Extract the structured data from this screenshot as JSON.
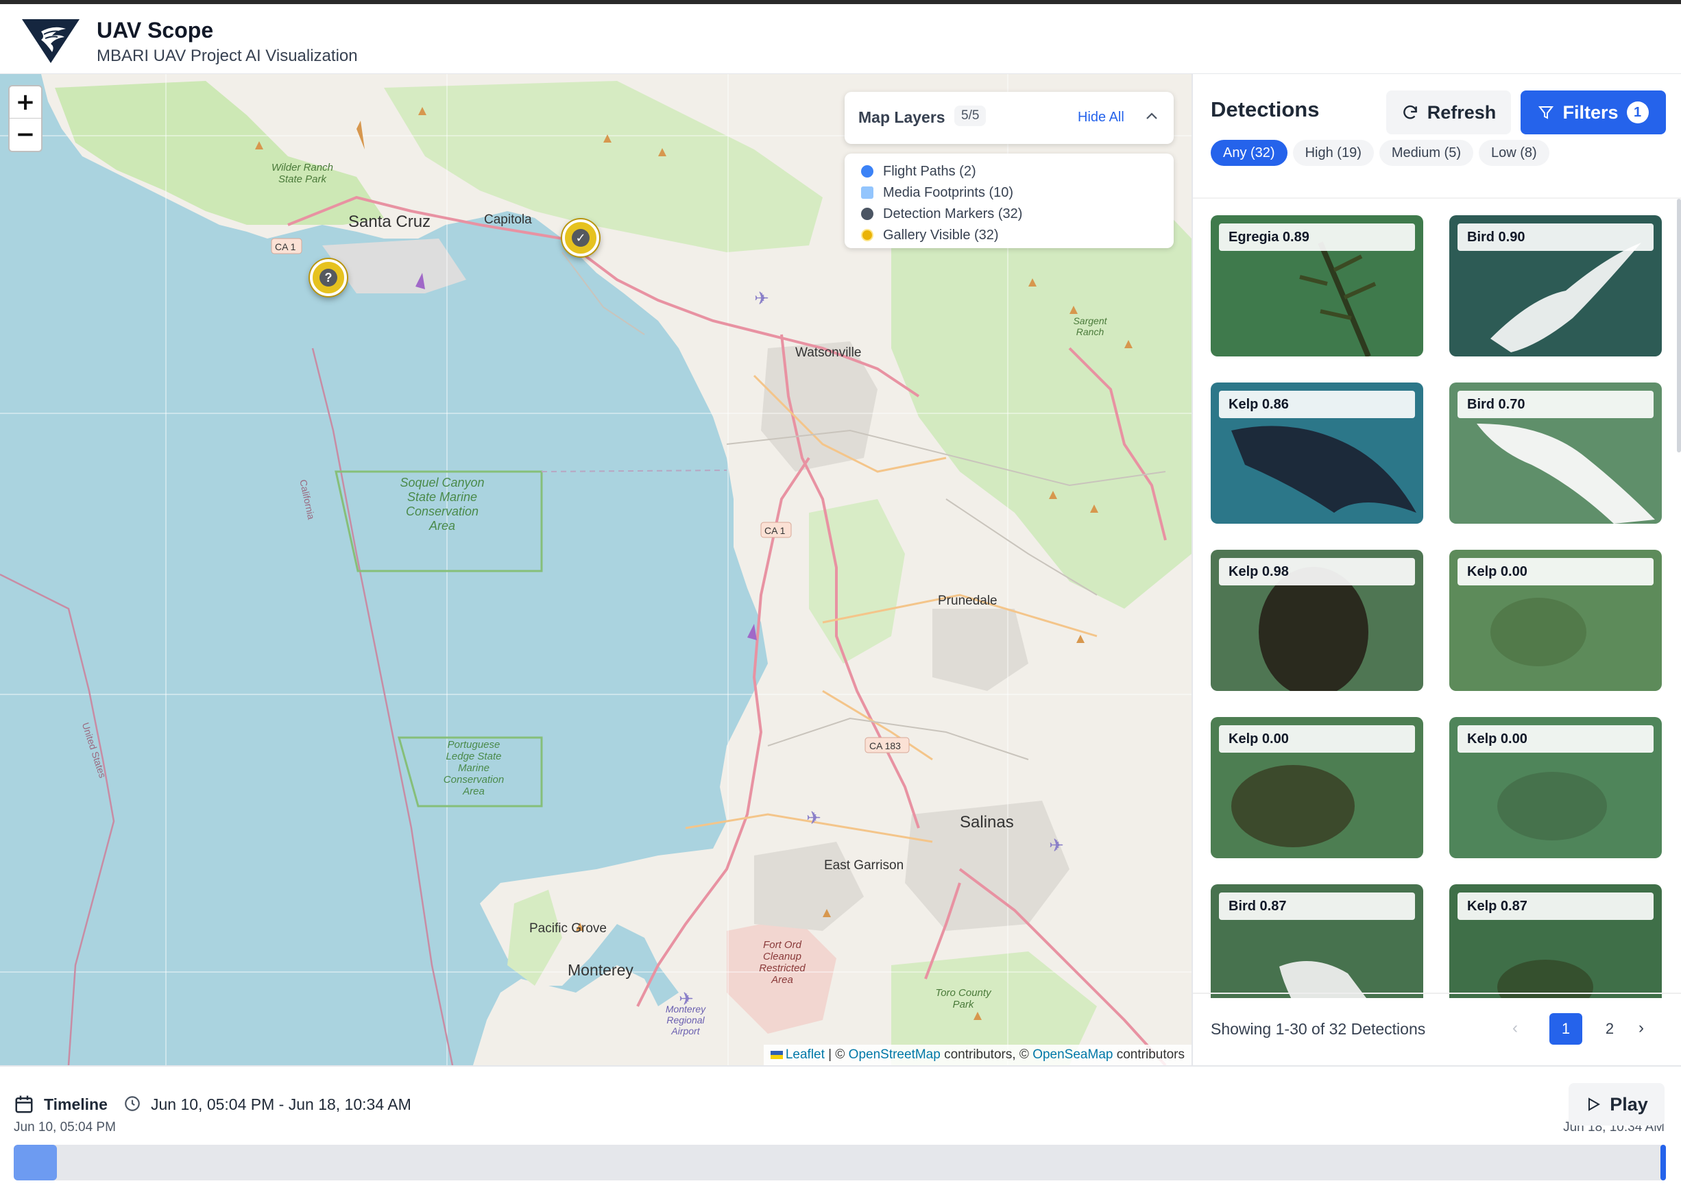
{
  "app": {
    "title": "UAV Scope",
    "subtitle": "MBARI UAV Project AI Visualization",
    "logo_icon": "stingray-logo-icon"
  },
  "map": {
    "zoom_in_label": "+",
    "zoom_out_label": "−",
    "places": {
      "santa_cruz": "Santa Cruz",
      "capitola": "Capitola",
      "watsonville": "Watsonville",
      "prunedale": "Prunedale",
      "salinas": "Salinas",
      "east_garrison": "East Garrison",
      "pacific_grove": "Pacific Grove",
      "monterey": "Monterey",
      "wilder_ranch": "Wilder Ranch State Park",
      "soquel_canyon": "Soquel Canyon State Marine Conservation Area",
      "portuguese_ledge": "Portuguese Ledge State Marine Conservation Area",
      "fort_ord": "Fort Ord Cleanup Restricted Area",
      "toro_park": "Toro County Park",
      "sargent_ranch": "Sargent Ranch",
      "monterey_airport": "Monterey Regional Airport",
      "california": "California",
      "united_states": "United States",
      "ca1_a": "CA 1",
      "ca1_b": "CA 1",
      "ca183": "CA 183"
    },
    "attribution": {
      "leaflet": "Leaflet",
      "sep": " | © ",
      "osm": "OpenStreetMap",
      "contrib1": " contributors, © ",
      "osmap": "OpenSeaMap",
      "contrib2": " contributors"
    },
    "markers": [
      {
        "icon": "question-icon",
        "glyph": "?"
      },
      {
        "icon": "check-icon",
        "glyph": "✓"
      }
    ]
  },
  "layers": {
    "title": "Map Layers",
    "count": "5/5",
    "hide_all": "Hide All",
    "items": [
      {
        "label": "Flight Paths (2)",
        "color": "#3b82f6"
      },
      {
        "label": "Media Footprints (10)",
        "color": "#93c5fd"
      },
      {
        "label": "Detection Markers (32)",
        "color": "#4b5563"
      },
      {
        "label": "Gallery Visible (32)",
        "color": "#eab308"
      }
    ]
  },
  "detections": {
    "title": "Detections",
    "refresh_label": "Refresh",
    "filters_label": "Filters",
    "filters_count": "1",
    "chips": [
      "Any (32)",
      "High (19)",
      "Medium (5)",
      "Low (8)"
    ],
    "active_chip": "Any (32)",
    "cards": [
      {
        "label": "Egregia 0.89",
        "bg": "#3f7a4c"
      },
      {
        "label": "Bird 0.90",
        "bg": "#2d5b55"
      },
      {
        "label": "Kelp 0.86",
        "bg": "#2c7789"
      },
      {
        "label": "Bird 0.70",
        "bg": "#5f8f6a"
      },
      {
        "label": "Kelp 0.98",
        "bg": "#4f7653"
      },
      {
        "label": "Kelp 0.00",
        "bg": "#5d8b5a"
      },
      {
        "label": "Kelp 0.00",
        "bg": "#4d7e52"
      },
      {
        "label": "Kelp 0.00",
        "bg": "#4f855a"
      },
      {
        "label": "Bird 0.87",
        "bg": "#47724e"
      },
      {
        "label": "Kelp 0.87",
        "bg": "#3f6f48"
      }
    ],
    "pager": {
      "summary": "Showing 1-30 of 32 Detections",
      "prev": "‹",
      "page1": "1",
      "page2": "2",
      "next": "›"
    }
  },
  "timeline": {
    "label": "Timeline",
    "range": "Jun 10, 05:04 PM - Jun 18, 10:34 AM",
    "start": "Jun 10, 05:04 PM",
    "end": "Jun 18, 10:34 AM",
    "play_label": "Play",
    "progress": 0.026
  }
}
